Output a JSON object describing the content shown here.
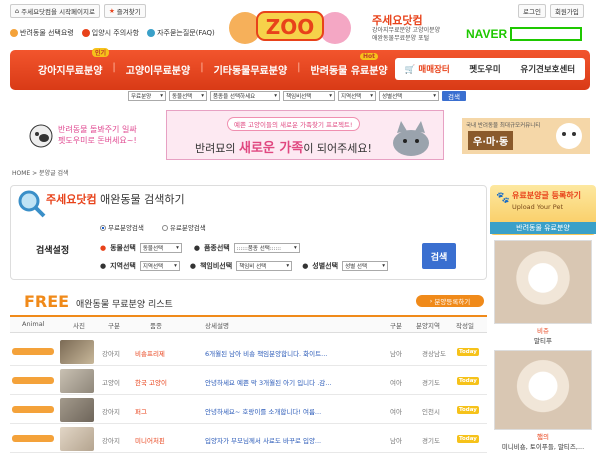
{
  "header": {
    "toplinks": [
      "주세요닷컴을 시작페이지로",
      "즐겨찾기"
    ],
    "quicklinks": [
      "반려동물 선택요령",
      "입양시 주의사항",
      "자주묻는질문(FAQ)"
    ],
    "logo_text": "ZOO",
    "site_title": "주세요닷컴",
    "site_sub": [
      "강아지무료분양 고양이분양",
      "애완동물무료분양 포털"
    ],
    "login": "로그인",
    "join": "회원가입",
    "naver": "NAVER"
  },
  "nav": {
    "badge_popular": "인기",
    "badge_hot": "Hot",
    "items": [
      "강아지무료분양",
      "고양이무료분양",
      "기타동물무료분양",
      "반려동물 유료분양"
    ],
    "right": [
      "매매장터",
      "펫도우미",
      "유기견보호센터"
    ]
  },
  "filters": {
    "selects": [
      "무료분양",
      "동물선택",
      "품종을 선택하세요",
      "책임비선택",
      "지역선택",
      "성별선택"
    ],
    "search": "검색"
  },
  "banners": {
    "left": [
      "반려동물 돌봐주기 일싸",
      "펫도우미로 돈버세요~!"
    ],
    "center_top": "예쁜 고양이들의 새로운 가족찾기 프로젝트!",
    "center_main_pre": "반려묘의 ",
    "center_main_em": "새로운 가족",
    "center_main_post": "이 되어주세요!",
    "right_small": "국내 반려동물 최대규모커뮤니티",
    "right_big": "우·마·동"
  },
  "breadcrumb": "HOME > 분양글 검색",
  "search_panel": {
    "title_a": "주세요닷컴",
    "title_b": " 애완동물 검색하기",
    "radio1": "무료분양검색",
    "radio2": "유료분양검색",
    "setting_label": "검색설정",
    "animal_label": "동물선택",
    "animal_value": "동물선택",
    "breed_label": "품종선택",
    "breed_value": "::::::품종 선택::::::",
    "region_label": "지역선택",
    "region_value": "지역선택",
    "fee_label": "책임비선택",
    "fee_value": "책임비 선택",
    "gender_label": "성별선택",
    "gender_value": "성별 선택",
    "button": "검색"
  },
  "list": {
    "free": "FREE",
    "title": "애완동물 무료분양 리스트",
    "register": "분양등록하기",
    "headers": [
      "Animal",
      "사진",
      "구분",
      "품종",
      "상세설명",
      "구분",
      "분양지역",
      "작성일"
    ],
    "rows": [
      {
        "type": "강아지",
        "breed": "비숑프리제",
        "desc": "6개월된 남아 비숑 책임분양합니다. 화이트...",
        "gender": "남아",
        "region": "경상남도",
        "date": "Today"
      },
      {
        "type": "고양이",
        "breed": "한국 고양이",
        "desc": "안녕하세요 예쁜 막 3개월된 아기 입니다 .감...",
        "gender": "여아",
        "region": "경기도",
        "date": "Today"
      },
      {
        "type": "강아지",
        "breed": "퍼그",
        "desc": "안녕하세요~ 호랑이를 소개합니다! 여름...",
        "gender": "여아",
        "region": "인천시",
        "date": "Today"
      },
      {
        "type": "강아지",
        "breed": "미니어처핀",
        "desc": "입양자가 부모님께서 사료도 바꾸로 입양...",
        "gender": "남아",
        "region": "경기도",
        "date": "Today"
      }
    ]
  },
  "sidebar": {
    "top1": "유료분양글 등록하기",
    "top2": "Upload Your Pet",
    "bar": "반려동물 유료분양",
    "cards": [
      {
        "name": "비쥬",
        "breed": "말티푸"
      },
      {
        "name": "햄의",
        "breed": "미니비숑, 토이푸들, 말티즈,..."
      }
    ]
  }
}
